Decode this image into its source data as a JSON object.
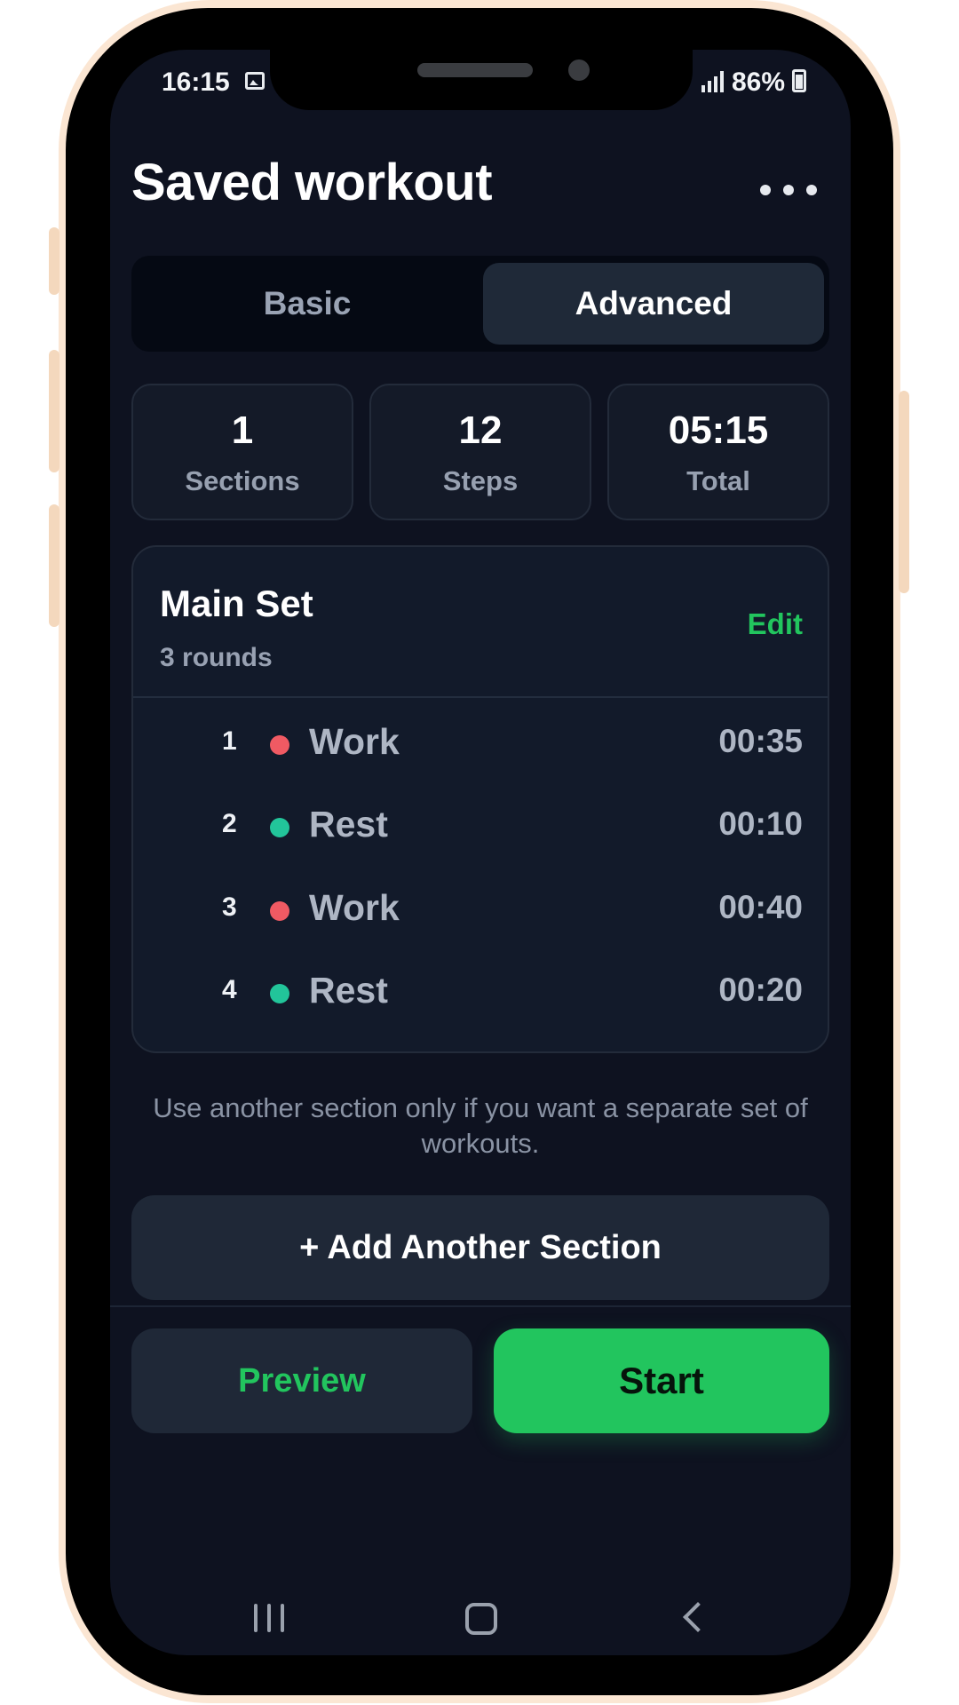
{
  "status_bar": {
    "time": "16:15",
    "battery": "86%"
  },
  "header": {
    "title": "Saved workout"
  },
  "tabs": [
    {
      "label": "Basic",
      "active": false
    },
    {
      "label": "Advanced",
      "active": true
    }
  ],
  "stats": [
    {
      "value": "1",
      "label": "Sections"
    },
    {
      "value": "12",
      "label": "Steps"
    },
    {
      "value": "05:15",
      "label": "Total"
    }
  ],
  "section": {
    "title": "Main Set",
    "subtitle": "3 rounds",
    "edit_label": "Edit",
    "steps": [
      {
        "number": "1",
        "name": "Work",
        "time": "00:35",
        "color": "#f05a63"
      },
      {
        "number": "2",
        "name": "Rest",
        "time": "00:10",
        "color": "#22c59a"
      },
      {
        "number": "3",
        "name": "Work",
        "time": "00:40",
        "color": "#f05a63"
      },
      {
        "number": "4",
        "name": "Rest",
        "time": "00:20",
        "color": "#22c59a"
      }
    ]
  },
  "hint": "Use another section only if you want a separate set of workouts.",
  "buttons": {
    "add_section": "+ Add Another Section",
    "preview": "Preview",
    "start": "Start"
  },
  "colors": {
    "accent": "#22c55e",
    "background": "#0e1220",
    "card": "#121a2a"
  }
}
